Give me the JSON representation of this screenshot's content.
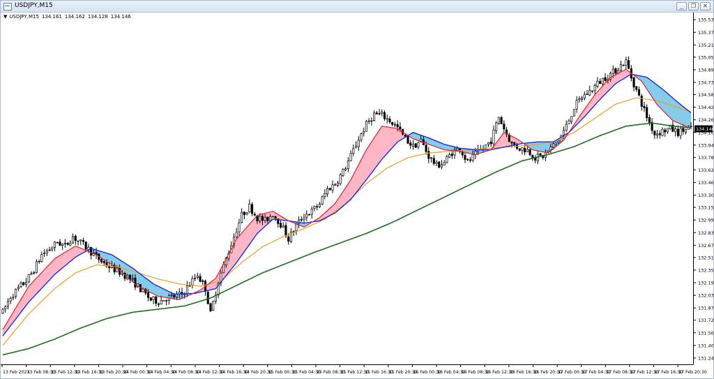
{
  "window": {
    "title": "USDJPY,M15",
    "buttons": {
      "minimize": "_",
      "restore": "❐",
      "close": "✕"
    }
  },
  "ohlc": {
    "arrow": "▼",
    "symbol": "USDJPY,M15",
    "open": "134.161",
    "high": "134.162",
    "low": "134.128",
    "close": "134.146"
  },
  "colors": {
    "candle": "#000000",
    "fast_ma": "#e8202a",
    "slow_ma": "#1530e0",
    "mid_ma": "#f39b24",
    "long_ma": "#1b6e1b",
    "bull_fill": "#ffb6c4",
    "bear_fill": "#87cbea",
    "price_tag": "#000000"
  },
  "chart_data": {
    "type": "line",
    "price_axis": {
      "min": 131.16,
      "max": 135.62,
      "ticks": [
        "135.530",
        "135.370",
        "135.210",
        "135.055",
        "134.895",
        "134.735",
        "134.580",
        "134.420",
        "134.260",
        "134.100",
        "133.940",
        "133.785",
        "133.625",
        "133.465",
        "133.305",
        "133.150",
        "132.990",
        "132.830",
        "132.670",
        "132.515",
        "132.355",
        "132.195",
        "132.035",
        "131.875",
        "131.720",
        "131.560",
        "131.400",
        "131.240"
      ],
      "current_price": "134.146"
    },
    "time_axis": {
      "labels": [
        "13 Feb 2023",
        "13 Feb 08:30",
        "13 Feb 12:30",
        "13 Feb 16:30",
        "13 Feb 20:30",
        "14 Feb 00:30",
        "14 Feb 04:30",
        "14 Feb 08:30",
        "14 Feb 12:30",
        "14 Feb 16:30",
        "14 Feb 20:30",
        "15 Feb 00:30",
        "15 Feb 04:30",
        "15 Feb 08:30",
        "15 Feb 12:30",
        "15 Feb 16:30",
        "15 Feb 20:30",
        "16 Feb 00:30",
        "16 Feb 04:30",
        "16 Feb 08:30",
        "16 Feb 12:30",
        "16 Feb 16:30",
        "16 Feb 20:30",
        "17 Feb 00:30",
        "17 Feb 04:30",
        "17 Feb 08:30",
        "17 Feb 12:30",
        "17 Feb 16:30",
        "17 Feb 20:30"
      ]
    },
    "price_path": [
      [
        0,
        131.82
      ],
      [
        3,
        132.02
      ],
      [
        6,
        132.12
      ],
      [
        9,
        132.22
      ],
      [
        12,
        132.36
      ],
      [
        15,
        132.55
      ],
      [
        18,
        132.62
      ],
      [
        21,
        132.71
      ],
      [
        24,
        132.66
      ],
      [
        27,
        132.78
      ],
      [
        30,
        132.7
      ],
      [
        33,
        132.62
      ],
      [
        36,
        132.52
      ],
      [
        39,
        132.44
      ],
      [
        42,
        132.38
      ],
      [
        45,
        132.33
      ],
      [
        48,
        132.27
      ],
      [
        51,
        132.18
      ],
      [
        54,
        132.08
      ],
      [
        57,
        131.98
      ],
      [
        60,
        131.96
      ],
      [
        63,
        132.0
      ],
      [
        66,
        132.02
      ],
      [
        69,
        132.05
      ],
      [
        72,
        132.18
      ],
      [
        75,
        132.3
      ],
      [
        78,
        132.12
      ],
      [
        80,
        131.8
      ],
      [
        83,
        132.22
      ],
      [
        86,
        132.5
      ],
      [
        89,
        132.78
      ],
      [
        92,
        133.05
      ],
      [
        95,
        133.16
      ],
      [
        98,
        133.02
      ],
      [
        101,
        132.98
      ],
      [
        104,
        133.07
      ],
      [
        107,
        132.94
      ],
      [
        110,
        132.75
      ],
      [
        113,
        132.92
      ],
      [
        116,
        133.05
      ],
      [
        119,
        133.1
      ],
      [
        122,
        133.2
      ],
      [
        125,
        133.38
      ],
      [
        128,
        133.45
      ],
      [
        131,
        133.6
      ],
      [
        134,
        133.8
      ],
      [
        137,
        134.02
      ],
      [
        140,
        134.2
      ],
      [
        143,
        134.33
      ],
      [
        146,
        134.32
      ],
      [
        149,
        134.25
      ],
      [
        152,
        134.16
      ],
      [
        155,
        134.02
      ],
      [
        158,
        133.92
      ],
      [
        161,
        134.0
      ],
      [
        164,
        133.8
      ],
      [
        167,
        133.68
      ],
      [
        170,
        133.72
      ],
      [
        173,
        133.85
      ],
      [
        176,
        133.9
      ],
      [
        179,
        133.72
      ],
      [
        182,
        133.82
      ],
      [
        185,
        133.9
      ],
      [
        188,
        134.0
      ],
      [
        191,
        134.3
      ],
      [
        193,
        134.15
      ],
      [
        196,
        133.95
      ],
      [
        199,
        133.9
      ],
      [
        202,
        133.88
      ],
      [
        205,
        133.78
      ],
      [
        208,
        133.8
      ],
      [
        211,
        133.9
      ],
      [
        214,
        134.0
      ],
      [
        217,
        134.18
      ],
      [
        220,
        134.42
      ],
      [
        223,
        134.55
      ],
      [
        226,
        134.62
      ],
      [
        229,
        134.72
      ],
      [
        232,
        134.8
      ],
      [
        235,
        134.86
      ],
      [
        238,
        134.95
      ],
      [
        240,
        135.0
      ],
      [
        242,
        134.8
      ],
      [
        245,
        134.55
      ],
      [
        248,
        134.3
      ],
      [
        251,
        134.08
      ],
      [
        254,
        134.12
      ],
      [
        257,
        134.15
      ],
      [
        260,
        134.1
      ],
      [
        263,
        134.14
      ],
      [
        265,
        134.146
      ]
    ],
    "fast_ma": [
      [
        0,
        131.6
      ],
      [
        10,
        132.15
      ],
      [
        20,
        132.5
      ],
      [
        28,
        132.66
      ],
      [
        36,
        132.55
      ],
      [
        44,
        132.38
      ],
      [
        52,
        132.15
      ],
      [
        60,
        132.02
      ],
      [
        68,
        131.98
      ],
      [
        76,
        132.1
      ],
      [
        82,
        132.25
      ],
      [
        90,
        132.75
      ],
      [
        98,
        133.05
      ],
      [
        104,
        133.1
      ],
      [
        110,
        132.98
      ],
      [
        116,
        132.9
      ],
      [
        122,
        133.02
      ],
      [
        128,
        133.2
      ],
      [
        134,
        133.5
      ],
      [
        140,
        133.88
      ],
      [
        146,
        134.18
      ],
      [
        152,
        134.15
      ],
      [
        158,
        134.02
      ],
      [
        164,
        133.95
      ],
      [
        170,
        133.88
      ],
      [
        176,
        133.86
      ],
      [
        182,
        133.82
      ],
      [
        188,
        133.88
      ],
      [
        193,
        134.1
      ],
      [
        198,
        134.02
      ],
      [
        204,
        133.88
      ],
      [
        210,
        133.84
      ],
      [
        216,
        134.0
      ],
      [
        222,
        134.3
      ],
      [
        228,
        134.58
      ],
      [
        234,
        134.8
      ],
      [
        240,
        134.9
      ],
      [
        246,
        134.75
      ],
      [
        252,
        134.45
      ],
      [
        258,
        134.25
      ],
      [
        265,
        134.15
      ]
    ],
    "slow_ma": [
      [
        0,
        131.52
      ],
      [
        10,
        131.95
      ],
      [
        20,
        132.3
      ],
      [
        28,
        132.52
      ],
      [
        34,
        132.63
      ],
      [
        42,
        132.55
      ],
      [
        50,
        132.38
      ],
      [
        58,
        132.18
      ],
      [
        66,
        132.05
      ],
      [
        74,
        132.06
      ],
      [
        82,
        132.12
      ],
      [
        90,
        132.45
      ],
      [
        98,
        132.82
      ],
      [
        104,
        133.0
      ],
      [
        110,
        132.98
      ],
      [
        116,
        132.95
      ],
      [
        122,
        132.98
      ],
      [
        128,
        133.08
      ],
      [
        134,
        133.25
      ],
      [
        140,
        133.5
      ],
      [
        146,
        133.76
      ],
      [
        152,
        133.98
      ],
      [
        158,
        134.1
      ],
      [
        164,
        134.03
      ],
      [
        170,
        133.95
      ],
      [
        176,
        133.9
      ],
      [
        182,
        133.88
      ],
      [
        188,
        133.88
      ],
      [
        194,
        133.92
      ],
      [
        200,
        133.96
      ],
      [
        206,
        133.98
      ],
      [
        212,
        133.98
      ],
      [
        218,
        134.1
      ],
      [
        224,
        134.3
      ],
      [
        230,
        134.52
      ],
      [
        236,
        134.72
      ],
      [
        242,
        134.84
      ],
      [
        248,
        134.8
      ],
      [
        254,
        134.65
      ],
      [
        260,
        134.48
      ],
      [
        265,
        134.35
      ]
    ],
    "mid_ma": [
      [
        0,
        131.4
      ],
      [
        10,
        131.8
      ],
      [
        20,
        132.12
      ],
      [
        28,
        132.32
      ],
      [
        36,
        132.42
      ],
      [
        44,
        132.4
      ],
      [
        52,
        132.32
      ],
      [
        60,
        132.24
      ],
      [
        68,
        132.18
      ],
      [
        76,
        132.15
      ],
      [
        84,
        132.22
      ],
      [
        92,
        132.45
      ],
      [
        100,
        132.65
      ],
      [
        108,
        132.78
      ],
      [
        116,
        132.88
      ],
      [
        124,
        133.0
      ],
      [
        132,
        133.2
      ],
      [
        140,
        133.45
      ],
      [
        148,
        133.65
      ],
      [
        156,
        133.78
      ],
      [
        164,
        133.84
      ],
      [
        172,
        133.86
      ],
      [
        180,
        133.88
      ],
      [
        188,
        133.9
      ],
      [
        196,
        133.92
      ],
      [
        204,
        133.94
      ],
      [
        212,
        133.98
      ],
      [
        220,
        134.1
      ],
      [
        228,
        134.28
      ],
      [
        236,
        134.46
      ],
      [
        244,
        134.54
      ],
      [
        252,
        134.5
      ],
      [
        258,
        134.44
      ],
      [
        265,
        134.36
      ]
    ],
    "long_ma": [
      [
        0,
        131.28
      ],
      [
        10,
        131.36
      ],
      [
        20,
        131.48
      ],
      [
        30,
        131.62
      ],
      [
        40,
        131.74
      ],
      [
        50,
        131.82
      ],
      [
        60,
        131.86
      ],
      [
        70,
        131.9
      ],
      [
        80,
        132.0
      ],
      [
        90,
        132.16
      ],
      [
        100,
        132.32
      ],
      [
        110,
        132.45
      ],
      [
        120,
        132.58
      ],
      [
        130,
        132.7
      ],
      [
        140,
        132.82
      ],
      [
        150,
        132.96
      ],
      [
        160,
        133.12
      ],
      [
        170,
        133.28
      ],
      [
        180,
        133.44
      ],
      [
        190,
        133.6
      ],
      [
        200,
        133.74
      ],
      [
        210,
        133.82
      ],
      [
        220,
        133.92
      ],
      [
        230,
        134.06
      ],
      [
        240,
        134.18
      ],
      [
        250,
        134.22
      ],
      [
        258,
        134.18
      ],
      [
        265,
        134.16
      ]
    ]
  }
}
